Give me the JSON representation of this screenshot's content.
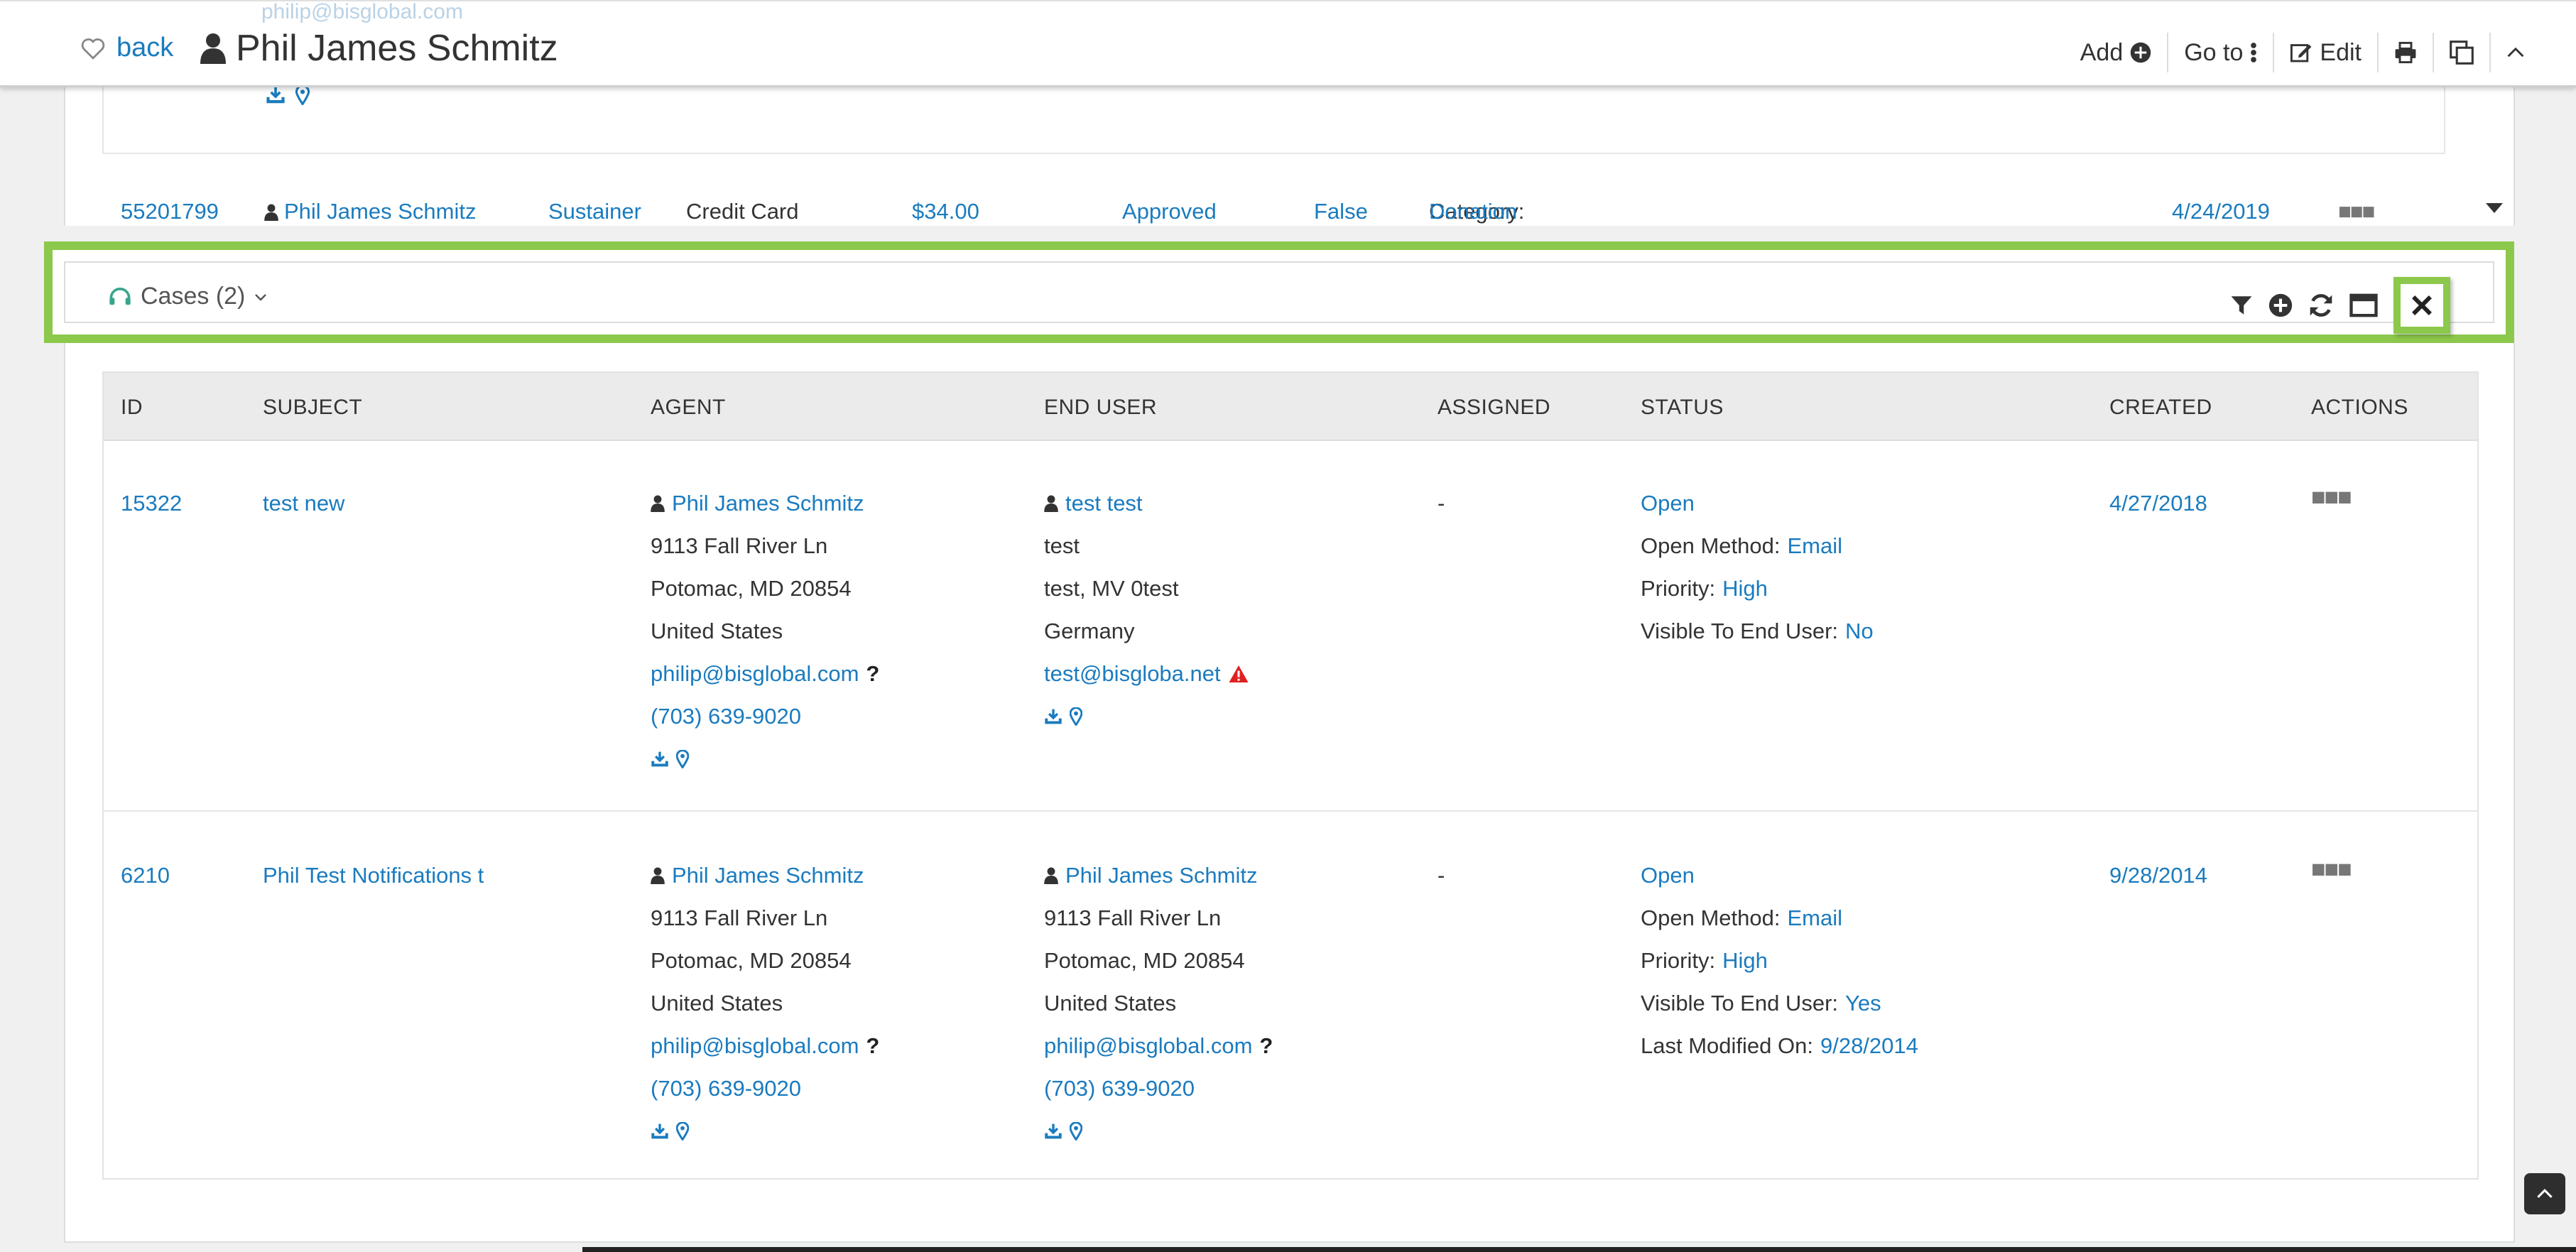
{
  "header": {
    "ghost_email": "philip@bisglobal.com",
    "back_label": "back",
    "title": "Phil James Schmitz",
    "toolbar": {
      "add": "Add",
      "goto": "Go to",
      "edit": "Edit"
    }
  },
  "transaction_row": {
    "id": "55201799",
    "name": "Phil James Schmitz",
    "type": "Sustainer",
    "method": "Credit Card",
    "amount": "$34.00",
    "status": "Approved",
    "flag": "False",
    "category_label": "Category:",
    "category_value": "Donation",
    "date": "4/24/2019"
  },
  "cases": {
    "title": "Cases (2)",
    "columns": [
      "ID",
      "SUBJECT",
      "AGENT",
      "END USER",
      "ASSIGNED",
      "STATUS",
      "CREATED",
      "ACTIONS"
    ],
    "rows": [
      {
        "id": "15322",
        "subject": "test new",
        "agent": {
          "name": "Phil James Schmitz",
          "street": "9113 Fall River Ln",
          "city": "Potomac, MD 20854",
          "country": "United States",
          "email": "philip@bisglobal.com",
          "phone": "(703) 639-9020"
        },
        "end_user": {
          "name": "test test",
          "street": "test",
          "city": "test, MV 0test",
          "country": "Germany",
          "email": "test@bisgloba.net"
        },
        "assigned": "-",
        "status": {
          "state": "Open",
          "open_method_label": "Open Method:",
          "open_method": "Email",
          "priority_label": "Priority:",
          "priority": "High",
          "visible_label": "Visible To End User:",
          "visible": "No"
        },
        "created": "4/27/2018"
      },
      {
        "id": "6210",
        "subject": "Phil Test Notifications t",
        "agent": {
          "name": "Phil James Schmitz",
          "street": "9113 Fall River Ln",
          "city": "Potomac, MD 20854",
          "country": "United States",
          "email": "philip@bisglobal.com",
          "phone": "(703) 639-9020"
        },
        "end_user": {
          "name": "Phil James Schmitz",
          "street": "9113 Fall River Ln",
          "city": "Potomac, MD 20854",
          "country": "United States",
          "email": "philip@bisglobal.com",
          "phone": "(703) 639-9020"
        },
        "assigned": "-",
        "status": {
          "state": "Open",
          "open_method_label": "Open Method:",
          "open_method": "Email",
          "priority_label": "Priority:",
          "priority": "High",
          "visible_label": "Visible To End User:",
          "visible": "Yes",
          "modified_label": "Last Modified On:",
          "modified": "9/28/2014"
        },
        "created": "9/28/2014"
      }
    ]
  },
  "colors": {
    "link": "#1a7bbf",
    "highlight": "#8cc84b",
    "warning": "#e02020",
    "cases_icon": "#3aa58a"
  }
}
